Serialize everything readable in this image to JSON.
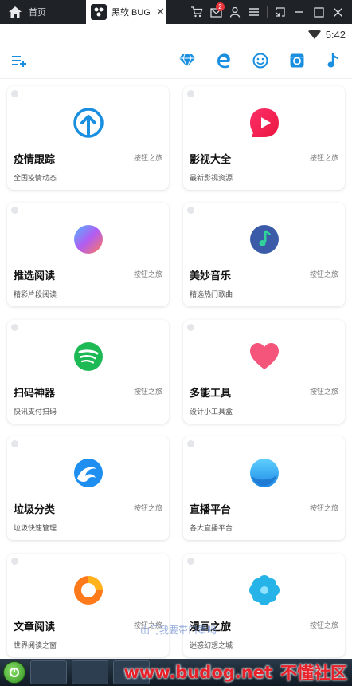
{
  "window": {
    "home_label": "首页",
    "tab_label": "黑软 BUG",
    "notification_count": "2"
  },
  "status": {
    "time": "5:42"
  },
  "toolbar_icons": [
    "add-list-icon",
    "diamond-icon",
    "browser-e-icon",
    "smiley-icon",
    "instagram-icon",
    "music-note-icon"
  ],
  "colors": {
    "accent": "#1a8fe0",
    "titlebar": "#1f2226",
    "badge": "#e5343a"
  },
  "cards": [
    {
      "title": "疫情跟踪",
      "tag": "按钮之旅",
      "subtitle": "全国疫情动态",
      "icon": "upload-arrow-icon"
    },
    {
      "title": "影视大全",
      "tag": "按钮之旅",
      "subtitle": "最新影视资源",
      "icon": "video-play-icon"
    },
    {
      "title": "推选阅读",
      "tag": "按钮之旅",
      "subtitle": "精彩片段阅读",
      "icon": "gradient-ball-icon"
    },
    {
      "title": "美妙音乐",
      "tag": "按钮之旅",
      "subtitle": "精选热门歌曲",
      "icon": "music-disc-icon"
    },
    {
      "title": "扫码神器",
      "tag": "按钮之旅",
      "subtitle": "快讯支付扫码",
      "icon": "spotify-icon"
    },
    {
      "title": "多能工具",
      "tag": "按钮之旅",
      "subtitle": "设计小工具盒",
      "icon": "heart-icon"
    },
    {
      "title": "垃圾分类",
      "tag": "按钮之旅",
      "subtitle": "垃圾快速管理",
      "icon": "wave-icon"
    },
    {
      "title": "直播平台",
      "tag": "按钮之旅",
      "subtitle": "各大直播平台",
      "icon": "live-drop-icon"
    },
    {
      "title": "文章阅读",
      "tag": "按钮之旅",
      "subtitle": "世界阅读之窗",
      "icon": "orange-ring-icon"
    },
    {
      "title": "漫画之旅",
      "tag": "按钮之旅",
      "subtitle": "迷惑幻想之城",
      "icon": "flower-icon"
    }
  ],
  "watermark": "山门我要带口罩吗",
  "branding": {
    "url": "www.budog.net",
    "name": "不懂社区"
  }
}
